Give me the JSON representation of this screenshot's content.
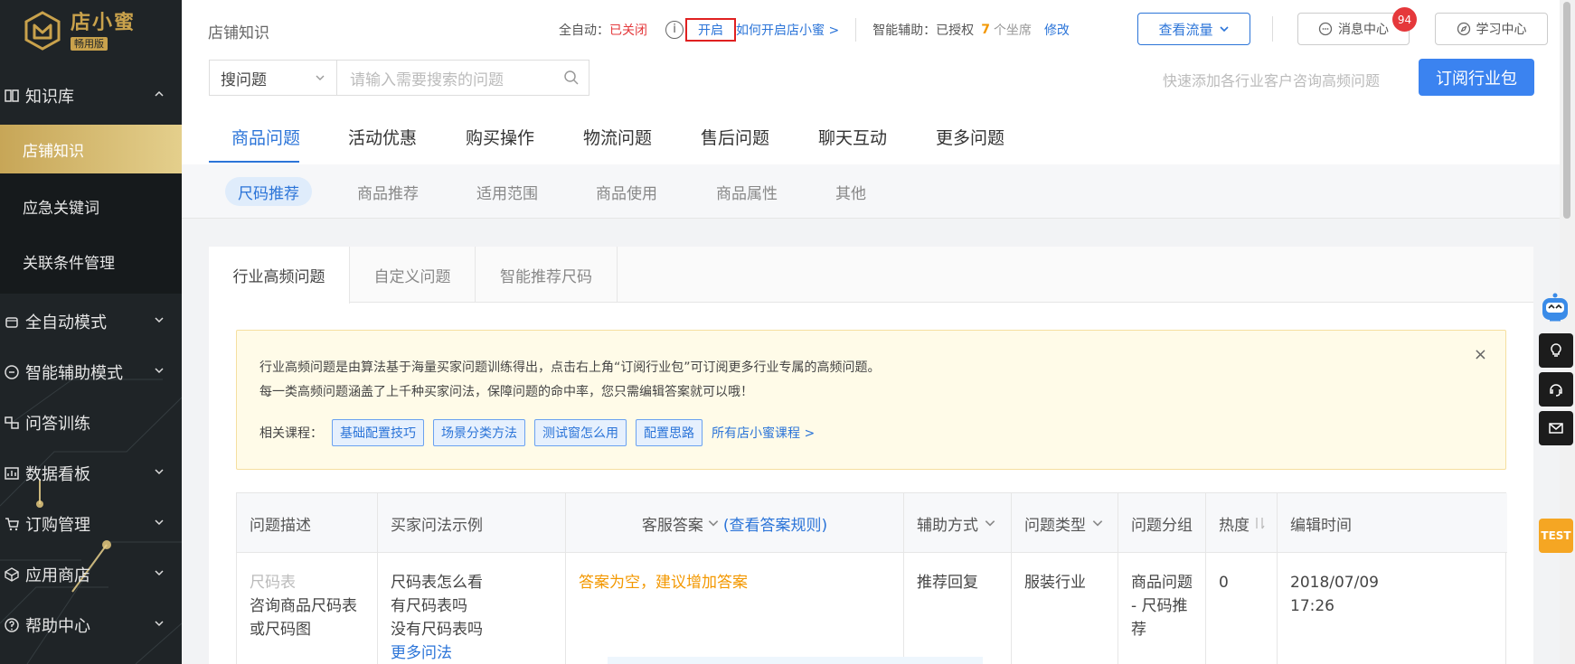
{
  "app": {
    "logo_title": "店小蜜",
    "logo_badge": "畅用版"
  },
  "sidebar": {
    "groups": [
      {
        "label": "知识库",
        "icon": "book-icon",
        "expanded": true
      },
      {
        "label": "全自动模式",
        "icon": "robot-icon"
      },
      {
        "label": "智能辅助模式",
        "icon": "assist-icon"
      },
      {
        "label": "问答训练",
        "icon": "training-icon"
      },
      {
        "label": "数据看板",
        "icon": "dashboard-icon"
      },
      {
        "label": "订购管理",
        "icon": "cart-icon"
      },
      {
        "label": "应用商店",
        "icon": "cube-icon"
      },
      {
        "label": "帮助中心",
        "icon": "help-icon"
      }
    ],
    "sub_items": [
      {
        "label": "店铺知识",
        "active": true
      },
      {
        "label": "应急关键词"
      },
      {
        "label": "关联条件管理"
      }
    ]
  },
  "header": {
    "page_title": "店铺知识",
    "auto_label": "全自动：",
    "auto_status": "已关闭",
    "info_symbol": "i",
    "open_label": "开启",
    "how_to_link": "如何开启店小蜜 >",
    "assist_label": "智能辅助：已授权",
    "seat_count": "7",
    "seat_unit": "个坐席",
    "modify_link": "修改",
    "flow_button": "查看流量",
    "message_button": "消息中心",
    "message_count": "94",
    "learn_button": "学习中心"
  },
  "search": {
    "type_label": "搜问题",
    "placeholder": "请输入需要搜索的问题",
    "hint": "快速添加各行业客户咨询高频问题",
    "subscribe_button": "订阅行业包"
  },
  "main_tabs": [
    {
      "label": "商品问题",
      "active": true
    },
    {
      "label": "活动优惠"
    },
    {
      "label": "购买操作"
    },
    {
      "label": "物流问题"
    },
    {
      "label": "售后问题"
    },
    {
      "label": "聊天互动"
    },
    {
      "label": "更多问题"
    }
  ],
  "sub_tabs": [
    {
      "label": "尺码推荐",
      "active": true
    },
    {
      "label": "商品推荐"
    },
    {
      "label": "适用范围"
    },
    {
      "label": "商品使用"
    },
    {
      "label": "商品属性"
    },
    {
      "label": "其他"
    }
  ],
  "content_tabs": [
    {
      "label": "行业高频问题",
      "active": true
    },
    {
      "label": "自定义问题"
    },
    {
      "label": "智能推荐尺码"
    }
  ],
  "notice": {
    "line1": "行业高频问题是由算法基于海量买家问题训练得出，点击右上角“订阅行业包”可订阅更多行业专属的高频问题。",
    "line2": "每一类高频问题涵盖了上千种买家问法，保障问题的命中率，您只需编辑答案就可以哦！",
    "courses_label": "相关课程：",
    "courses": [
      "基础配置技巧",
      "场景分类方法",
      "测试窗怎么用",
      "配置思路"
    ],
    "all_courses_link": "所有店小蜜课程 >",
    "close_symbol": "×"
  },
  "table": {
    "headers": {
      "desc": "问题描述",
      "examples": "买家问法示例",
      "answer": "客服答案",
      "answer_rule": "(查看答案规则)",
      "assist": "辅助方式",
      "type": "问题类型",
      "group": "问题分组",
      "heat": "热度",
      "time": "编辑时间"
    },
    "rows": [
      {
        "desc_tag": "尺码表",
        "desc": "咨询商品尺码表或尺码图",
        "examples": [
          "尺码表怎么看",
          "有尺码表吗",
          "没有尺码表吗"
        ],
        "more_link": "更多问法",
        "answer": "答案为空，建议增加答案",
        "assist": "推荐回复",
        "type": "服装行业",
        "group": "商品问题 - 尺码推荐",
        "heat": "0",
        "date": "2018/07/09",
        "time": "17:26"
      }
    ]
  },
  "floating": {
    "test_label": "TEST"
  },
  "colors": {
    "sidebar_bg": "#1f2427",
    "gold": "#c9a24c",
    "primary": "#2b74d8",
    "danger": "#e4393c",
    "warning": "#f39800"
  }
}
